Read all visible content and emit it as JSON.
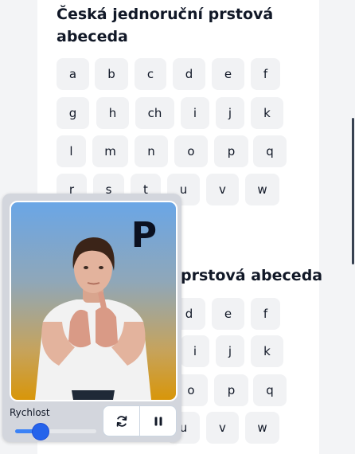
{
  "section1": {
    "title_line1": "Česká jednoruční prstová",
    "title_line2": "abeceda",
    "rows": [
      [
        "a",
        "b",
        "c",
        "d",
        "e",
        "f"
      ],
      [
        "g",
        "h",
        "ch",
        "i",
        "j",
        "k"
      ],
      [
        "l",
        "m",
        "n",
        "o",
        "p",
        "q"
      ],
      [
        "r",
        "s",
        "t",
        "u",
        "v",
        "w"
      ]
    ]
  },
  "section2": {
    "title_visible": "prstová abeceda",
    "rows": [
      [
        "d",
        "e",
        "f"
      ],
      [
        "i",
        "j",
        "k"
      ],
      [
        "o",
        "p",
        "q"
      ],
      [
        "u",
        "v",
        "w"
      ]
    ]
  },
  "player": {
    "current_letter": "P",
    "speed_label": "Rychlost",
    "speed_value": 0.3,
    "replay_icon": "replay-icon",
    "pause_icon": "pause-icon"
  },
  "colors": {
    "accent": "#3b82f6",
    "key_bg": "#f1f2f4"
  }
}
